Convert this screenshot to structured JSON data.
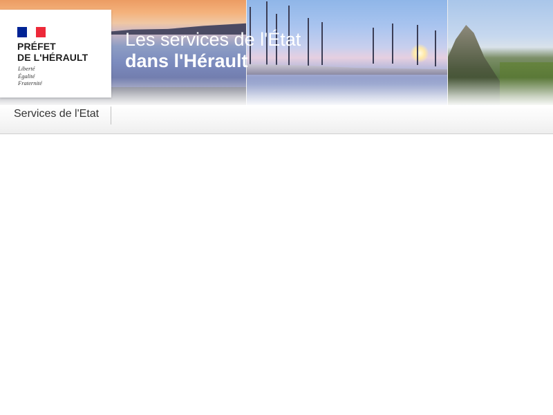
{
  "header": {
    "title_line1": "Les services de l'État",
    "title_line2": "dans l'Hérault"
  },
  "logo": {
    "name_line1": "PRÉFET",
    "name_line2": "DE L'HÉRAULT",
    "motto": [
      "Liberté",
      "Égalité",
      "Fraternité"
    ],
    "flag_colors": [
      "#002395",
      "#ffffff",
      "#ed2939"
    ]
  },
  "nav": {
    "items": [
      {
        "label": "Services de l'Etat"
      }
    ]
  },
  "colors": {
    "text_dark": "#333333",
    "nav_border": "#cfcfcf"
  }
}
